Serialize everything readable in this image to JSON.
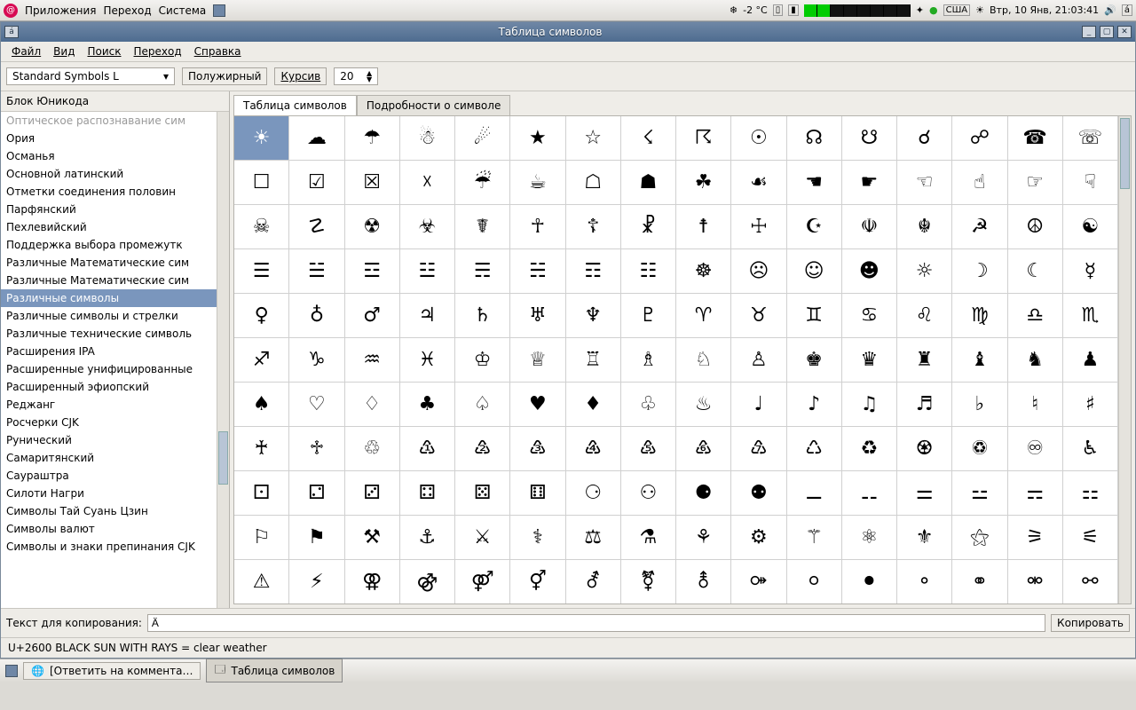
{
  "os_panel": {
    "menu": [
      "Приложения",
      "Переход",
      "Система"
    ],
    "weather": "-2 °C",
    "kb_layout": "США",
    "date": "Втр, 10 Янв, 21:03:41",
    "tray_a": "á"
  },
  "window": {
    "title": "Таблица символов",
    "left_btn": "á",
    "menubar": [
      "Файл",
      "Вид",
      "Поиск",
      "Переход",
      "Справка"
    ],
    "toolbar": {
      "font": "Standard Symbols L",
      "bold": "Полужирный",
      "italic": "Курсив",
      "size": "20"
    },
    "sidebar": {
      "header": "Блок Юникода",
      "items": [
        {
          "label": "Оптическое распознавание сим",
          "dim": true
        },
        {
          "label": "Ория"
        },
        {
          "label": "Османья"
        },
        {
          "label": "Основной латинский"
        },
        {
          "label": "Отметки соединения половин"
        },
        {
          "label": "Парфянский"
        },
        {
          "label": "Пехлевийский"
        },
        {
          "label": "Поддержка выбора промежутк"
        },
        {
          "label": "Различные Математические сим"
        },
        {
          "label": "Различные Математические сим"
        },
        {
          "label": "Различные символы",
          "sel": true
        },
        {
          "label": "Различные символы и стрелки"
        },
        {
          "label": "Различные технические символь"
        },
        {
          "label": "Расширения IPA"
        },
        {
          "label": "Расширенные унифицированные"
        },
        {
          "label": "Расширенный эфиопский"
        },
        {
          "label": "Реджанг"
        },
        {
          "label": "Росчерки CJK"
        },
        {
          "label": "Рунический"
        },
        {
          "label": "Самаритянский"
        },
        {
          "label": "Саураштра"
        },
        {
          "label": "Силоти Нагри"
        },
        {
          "label": "Символы Тай Суань Цзин"
        },
        {
          "label": "Символы валют"
        },
        {
          "label": "Символы и знаки препинания CJK"
        }
      ]
    },
    "tabs": {
      "chars": "Таблица символов",
      "details": "Подробности о символе"
    },
    "grid": [
      [
        "☀",
        "☁",
        "☂",
        "☃",
        "☄",
        "★",
        "☆",
        "☇",
        "☈",
        "☉",
        "☊",
        "☋",
        "☌",
        "☍",
        "☎",
        "☏"
      ],
      [
        "☐",
        "☑",
        "☒",
        "☓",
        "☔",
        "☕",
        "☖",
        "☗",
        "☘",
        "☙",
        "☚",
        "☛",
        "☜",
        "☝",
        "☞",
        "☟"
      ],
      [
        "☠",
        "☡",
        "☢",
        "☣",
        "☤",
        "☥",
        "☦",
        "☧",
        "☨",
        "☩",
        "☪",
        "☫",
        "☬",
        "☭",
        "☮",
        "☯"
      ],
      [
        "☰",
        "☱",
        "☲",
        "☳",
        "☴",
        "☵",
        "☶",
        "☷",
        "☸",
        "☹",
        "☺",
        "☻",
        "☼",
        "☽",
        "☾",
        "☿"
      ],
      [
        "♀",
        "♁",
        "♂",
        "♃",
        "♄",
        "♅",
        "♆",
        "♇",
        "♈",
        "♉",
        "♊",
        "♋",
        "♌",
        "♍",
        "♎",
        "♏"
      ],
      [
        "♐",
        "♑",
        "♒",
        "♓",
        "♔",
        "♕",
        "♖",
        "♗",
        "♘",
        "♙",
        "♚",
        "♛",
        "♜",
        "♝",
        "♞",
        "♟"
      ],
      [
        "♠",
        "♡",
        "♢",
        "♣",
        "♤",
        "♥",
        "♦",
        "♧",
        "♨",
        "♩",
        "♪",
        "♫",
        "♬",
        "♭",
        "♮",
        "♯"
      ],
      [
        "♰",
        "♱",
        "♲",
        "♳",
        "♴",
        "♵",
        "♶",
        "♷",
        "♸",
        "♹",
        "♺",
        "♻",
        "♼",
        "♽",
        "♾",
        "♿"
      ],
      [
        "⚀",
        "⚁",
        "⚂",
        "⚃",
        "⚄",
        "⚅",
        "⚆",
        "⚇",
        "⚈",
        "⚉",
        "⚊",
        "⚋",
        "⚌",
        "⚍",
        "⚎",
        "⚏"
      ],
      [
        "⚐",
        "⚑",
        "⚒",
        "⚓",
        "⚔",
        "⚕",
        "⚖",
        "⚗",
        "⚘",
        "⚙",
        "⚚",
        "⚛",
        "⚜",
        "⚝",
        "⚞",
        "⚟"
      ],
      [
        "⚠",
        "⚡",
        "⚢",
        "⚣",
        "⚤",
        "⚥",
        "⚦",
        "⚧",
        "⚨",
        "⚩",
        "⚪",
        "⚫",
        "⚬",
        "⚭",
        "⚮",
        "⚯"
      ]
    ],
    "selected": [
      0,
      0
    ],
    "copy": {
      "label": "Текст для копирования:",
      "value": "Ä",
      "button": "Копировать"
    },
    "status": "U+2600 BLACK SUN WITH RAYS   = clear weather"
  },
  "taskbar": {
    "items": [
      {
        "label": "[Ответить на коммента…",
        "active": false
      },
      {
        "label": "Таблица символов",
        "active": true
      }
    ]
  }
}
